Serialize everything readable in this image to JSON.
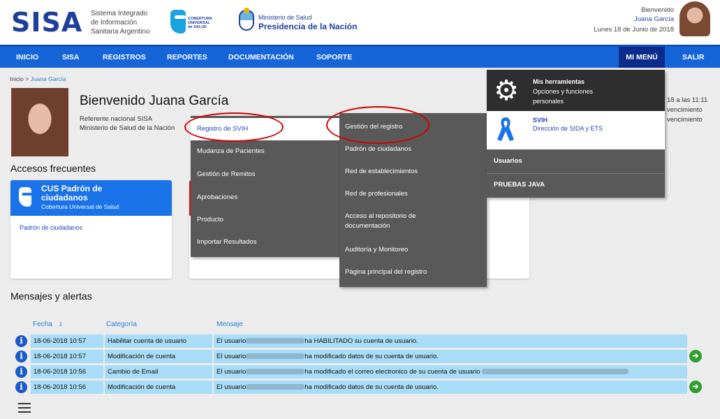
{
  "header": {
    "logo": "SISA",
    "logo_text": [
      "Sistema Integrado",
      "de Información",
      "Sanitaria Argentino"
    ],
    "cobertura_text": [
      "COBERTURA",
      "UNIVERSAL",
      "de SALUD"
    ],
    "ministerio_line1": "Ministerio de Salud",
    "ministerio_line2": "Presidencia de la Nación",
    "greeting": "Bienvenido",
    "user_name": "Juana García",
    "date": "Lunes 18 de Junio de 2018"
  },
  "nav": {
    "items": [
      "INICIO",
      "SISA",
      "REGISTROS",
      "REPORTES",
      "DOCUMENTACIÓN",
      "SOPORTE"
    ],
    "mi_menu": "MI MENÚ",
    "salir": "SALIR"
  },
  "breadcrumb": {
    "home": "Inicio",
    "sep": ">",
    "current": "Juana García"
  },
  "profile": {
    "welcome": "Bienvenido Juana García",
    "role_line1": "Referente nacional SISA",
    "role_line2": "Ministerio de Salud de la Nación",
    "right_line1": "18 a las 11:11",
    "right_line2": "vencimiento",
    "right_line3": "vencimiento"
  },
  "accesos": {
    "title": "Accesos frecuentes",
    "card1": {
      "title": "CUS Padrón de ciudadanos",
      "subtitle": "Cobertura Universal de Salud",
      "link": "Padrón de ciudadanos"
    }
  },
  "menu_registros": {
    "items": [
      "Registro de SVIH",
      "Mudanza de Pacientes",
      "Gestión de Remitos",
      "Aprobaciones",
      "Producto",
      "Importar Resultados"
    ]
  },
  "menu_svih": {
    "items": [
      "Gestión del registro",
      "Padrón de ciudadanos",
      "Red de establecimientos",
      "Red de profesionales",
      "Acceso al repositorio de documentación",
      "Auditoría y Monitoreo",
      "Página principal del registro"
    ]
  },
  "mi_menu": {
    "herramientas_title": "Mis herramientas",
    "herramientas_sub": "Opciones y funciones personales",
    "svih_title": "SVIH",
    "svih_sub": "Dirección de SIDA y ETS",
    "usuarios": "Usuarios",
    "pruebas": "PRUEBAS JAVA"
  },
  "mensajes": {
    "title": "Mensajes y alertas",
    "headers": {
      "fecha": "Fecha",
      "sort_icon": "⇩",
      "categoria": "Categoría",
      "mensaje": "Mensaje"
    },
    "rows": [
      {
        "fecha": "18-06-2018 10:57",
        "categoria": "Habilitar cuenta de usuario",
        "pre": "El usuario",
        "post": "ha HABILITADO su cuenta de usuario."
      },
      {
        "fecha": "18-06-2018 10:57",
        "categoria": "Modificación de cuenta",
        "pre": "El usuario",
        "post": "ha modificado datos de su cuenta de usuario."
      },
      {
        "fecha": "18-06-2018 10:56",
        "categoria": "Cambio de Email",
        "pre": "El usuario",
        "post": "ha modificado el correo electronico de su cuenta de usuario"
      },
      {
        "fecha": "18-06-2018 10:56",
        "categoria": "Modificación de cuenta",
        "pre": "El usuario",
        "post": "ha modificado datos de su cuenta de usuario."
      }
    ]
  },
  "icons": {
    "info": "i",
    "arrow": "➔",
    "gear": "⚙"
  }
}
